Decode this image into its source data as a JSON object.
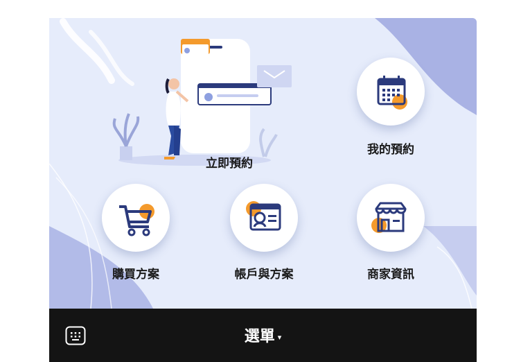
{
  "tiles": {
    "book_now": {
      "label": "立即預約"
    },
    "my_bookings": {
      "label": "我的預約"
    },
    "buy_plans": {
      "label": "購買方案"
    },
    "account_plans": {
      "label": "帳戶與方案"
    },
    "store_info": {
      "label": "商家資訊"
    }
  },
  "icons": {
    "my_bookings": "calendar-icon",
    "buy_plans": "shopping-cart-icon",
    "account_plans": "profile-card-icon",
    "store_info": "storefront-icon",
    "keyboard": "keyboard-icon"
  },
  "menubar": {
    "menu_label": "選單",
    "caret": "▾"
  },
  "colors": {
    "accent_navy": "#2b3a7c",
    "accent_orange": "#f49a2c",
    "panel_bg": "#e6ecfb",
    "bar_bg": "#141414"
  }
}
